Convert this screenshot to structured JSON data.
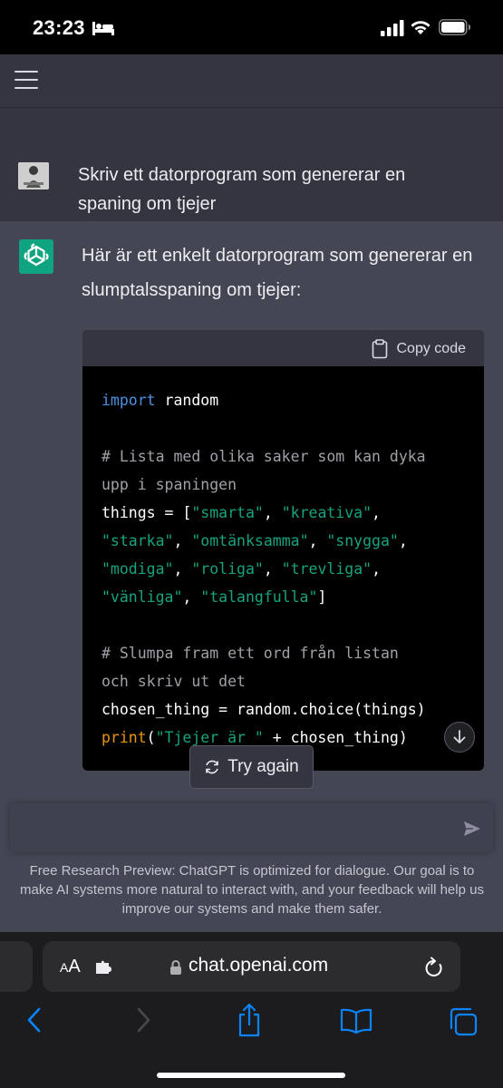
{
  "status_bar": {
    "time": "23:23"
  },
  "conversation": {
    "user_message": "Skriv ett datorprogram som genererar en spaning om tjejer",
    "assistant_message": "Här är ett enkelt datorprogram som genererar en slumptalsspaning om tjejer:",
    "code_block": {
      "copy_label": "Copy code",
      "lines": [
        "import random",
        "",
        "# Lista med olika saker som kan dyka",
        "upp i spaningen",
        "things = [\"smarta\", \"kreativa\",",
        "\"starka\", \"omtänksamma\", \"snygga\",",
        "\"modiga\", \"roliga\", \"trevliga\",",
        "\"vänliga\", \"talangfulla\"]",
        "",
        "# Slumpa fram ett ord från listan",
        "och skriv ut det",
        "chosen_thing = random.choice(things)",
        "print(\"Tjejer är \" + chosen_thing)"
      ]
    },
    "try_again_label": "Try again"
  },
  "composer": {
    "value": "",
    "placeholder": ""
  },
  "footer_note": "Free Research Preview: ChatGPT is optimized for dialogue. Our goal is to make AI systems more natural to interact with, and your feedback will help us improve our systems and make them safer.",
  "browser": {
    "text_size_label_small": "A",
    "text_size_label_large": "A",
    "url": "chat.openai.com"
  },
  "colors": {
    "background": "#343541",
    "assistant_background": "#444654",
    "accent": "#10a37f",
    "code_keyword": "#4a90e2",
    "code_string": "#16a37f",
    "code_function": "#e9950c",
    "code_comment": "#a0a0a8",
    "ios_blue": "#0a84ff"
  },
  "icons": [
    "bed-icon",
    "signal-icon",
    "wifi-icon",
    "battery-icon",
    "menu-icon",
    "openai-logo-icon",
    "clipboard-icon",
    "refresh-icon",
    "arrow-down-icon",
    "send-icon",
    "extension-icon",
    "lock-icon",
    "reload-icon",
    "back-icon",
    "forward-icon",
    "share-icon",
    "bookmarks-icon",
    "tabs-icon"
  ]
}
